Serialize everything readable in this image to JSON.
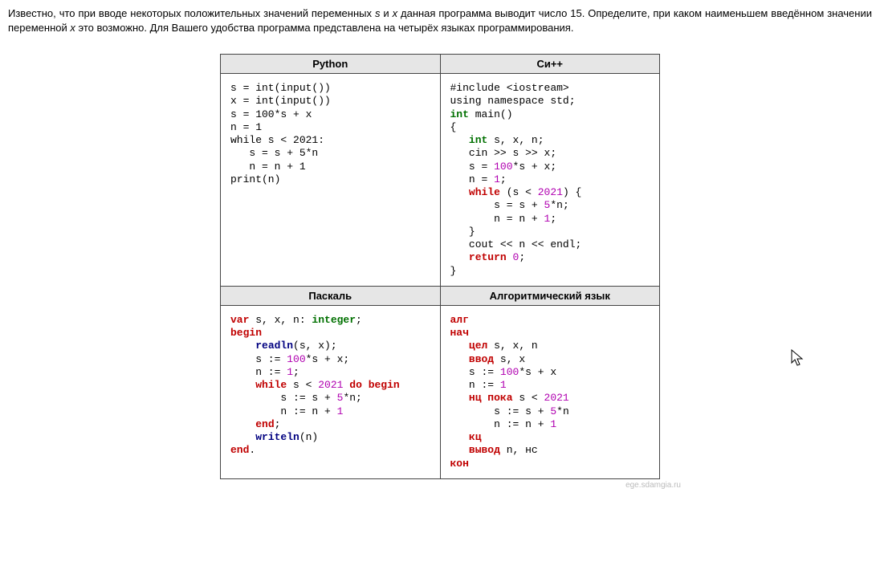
{
  "problem": {
    "line1_a": "Известно, что при вводе некоторых положительных значений переменных ",
    "var_s": "s",
    "line1_b": " и ",
    "var_x": "x",
    "line1_c": " данная программа выводит число 15.",
    "line2_a": "Определите, при каком наименьшем введённом значении переменной ",
    "var_x2": "x",
    "line2_b": " это возможно. Для Вашего удобства программа представлена на четырёх языках программирования."
  },
  "headers": {
    "python": "Python",
    "cpp": "Си++",
    "pascal": "Паскаль",
    "alg": "Алгоритмический язык"
  },
  "code": {
    "python": {
      "l1": "s = int(input())",
      "l2": "x = int(input())",
      "l3": "s = 100*s + x",
      "l4": "n = 1",
      "l5": "while s < 2021:",
      "l6": "   s = s + 5*n",
      "l7": "   n = n + 1",
      "l8": "print(n)"
    },
    "cpp": {
      "l1a": "#include <iostream>",
      "l2a": "using namespace std;",
      "kw_int": "int",
      "main": " main()",
      "ob": "{",
      "decl_a": "int",
      "decl_b": " s, x, n;",
      "cin": "   cin >> s >> x;",
      "assn_a": "   s = ",
      "num100": "100",
      "assn_b": "*s + x;",
      "n1a": "   n = ",
      "num1": "1",
      "n1b": ";",
      "kw_while": "while",
      "wh_b": " (s < ",
      "num2021": "2021",
      "wh_c": ") {",
      "body1a": "       s = s + ",
      "num5": "5",
      "body1b": "*n;",
      "body2a": "       n = n + ",
      "body2b": ";",
      "cb_inner": "   }",
      "cout": "   cout << n << endl;",
      "kw_return": "return",
      "ret_b": " ",
      "num0": "0",
      "ret_c": ";",
      "cb": "}"
    },
    "pascal": {
      "kw_var": "var",
      "var_b": " s, x, n: ",
      "kw_integer": "integer",
      "var_c": ";",
      "kw_begin": "begin",
      "fn_readln": "readln",
      "readln_b": "(s, x);",
      "s_assn_a": "    s := ",
      "s_assn_b": "*s + x;",
      "n_assn_a": "    n := ",
      "n_assn_b": ";",
      "kw_while": "while",
      "wh_b": " s < ",
      "wh_c": " ",
      "kw_do": "do",
      "kw_begin2": "begin",
      "body1a": "        s := s + ",
      "body1b": "*n;",
      "body2a": "        n := n + ",
      "kw_end_inner": "end",
      "end_inner_b": ";",
      "fn_writeln": "writeln",
      "writeln_b": "(n)",
      "kw_end": "end",
      "end_b": "."
    },
    "alg": {
      "kw_alg": "алг",
      "kw_nach": "нач",
      "kw_cel": "цел",
      "cel_b": " s, x, n",
      "kw_vvod": "ввод",
      "vvod_b": " s, x",
      "s_a": "   s := ",
      "s_b": "*s + x",
      "n_a": "   n := ",
      "kw_nc": "нц пока",
      "nc_b": " s < ",
      "body1a": "       s := s + ",
      "body1b": "*n",
      "body2a": "       n := n + ",
      "kw_kc": "кц",
      "kw_vyvod": "вывод",
      "vyvod_b": " n, нс",
      "kw_kon": "кон"
    },
    "nums": {
      "n100": "100",
      "n1": "1",
      "n5": "5",
      "n2021": "2021",
      "n0": "0"
    }
  },
  "footer": "ege.sdamgia.ru"
}
